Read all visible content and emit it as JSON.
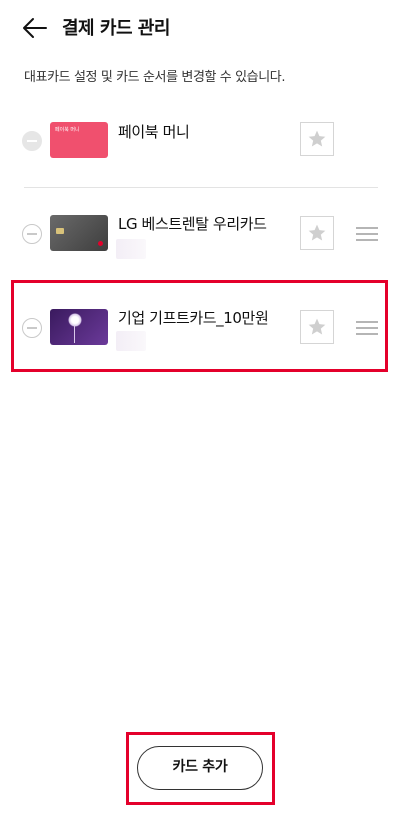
{
  "header": {
    "back_icon": "arrow-left-icon",
    "title": "결제 카드 관리"
  },
  "description": "대표카드 설정 및 카드 순서를 변경할 수 있습니다.",
  "cards": [
    {
      "name": "페이북 머니",
      "thumbnail_text": "페이북 머니",
      "primary_color": "#f0506e"
    },
    {
      "name": "LG 베스트렌탈 우리카드",
      "primary_color": "#555555"
    },
    {
      "name": "기업 기프트카드_10만원",
      "primary_color": "#5b2a86"
    }
  ],
  "footer": {
    "add_card_label": "카드 추가"
  },
  "accent_color": "#e4002b"
}
